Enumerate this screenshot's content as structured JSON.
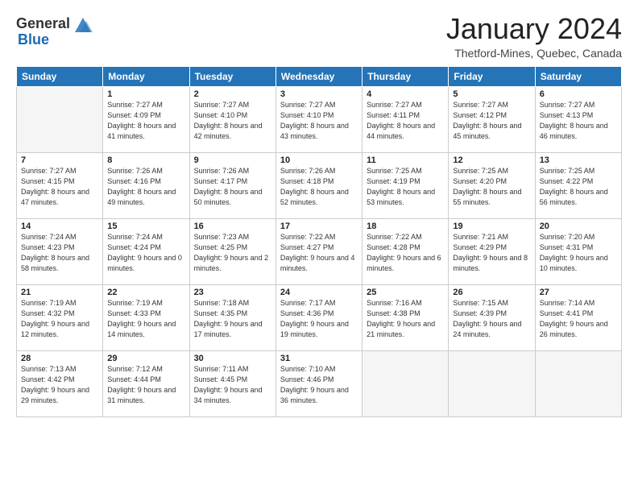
{
  "header": {
    "logo_general": "General",
    "logo_blue": "Blue",
    "month_title": "January 2024",
    "subtitle": "Thetford-Mines, Quebec, Canada"
  },
  "days_of_week": [
    "Sunday",
    "Monday",
    "Tuesday",
    "Wednesday",
    "Thursday",
    "Friday",
    "Saturday"
  ],
  "weeks": [
    [
      {
        "num": "",
        "empty": true,
        "sunrise": "",
        "sunset": "",
        "daylight": ""
      },
      {
        "num": "1",
        "empty": false,
        "sunrise": "7:27 AM",
        "sunset": "4:09 PM",
        "daylight": "8 hours and 41 minutes."
      },
      {
        "num": "2",
        "empty": false,
        "sunrise": "7:27 AM",
        "sunset": "4:10 PM",
        "daylight": "8 hours and 42 minutes."
      },
      {
        "num": "3",
        "empty": false,
        "sunrise": "7:27 AM",
        "sunset": "4:10 PM",
        "daylight": "8 hours and 43 minutes."
      },
      {
        "num": "4",
        "empty": false,
        "sunrise": "7:27 AM",
        "sunset": "4:11 PM",
        "daylight": "8 hours and 44 minutes."
      },
      {
        "num": "5",
        "empty": false,
        "sunrise": "7:27 AM",
        "sunset": "4:12 PM",
        "daylight": "8 hours and 45 minutes."
      },
      {
        "num": "6",
        "empty": false,
        "sunrise": "7:27 AM",
        "sunset": "4:13 PM",
        "daylight": "8 hours and 46 minutes."
      }
    ],
    [
      {
        "num": "7",
        "empty": false,
        "sunrise": "7:27 AM",
        "sunset": "4:15 PM",
        "daylight": "8 hours and 47 minutes."
      },
      {
        "num": "8",
        "empty": false,
        "sunrise": "7:26 AM",
        "sunset": "4:16 PM",
        "daylight": "8 hours and 49 minutes."
      },
      {
        "num": "9",
        "empty": false,
        "sunrise": "7:26 AM",
        "sunset": "4:17 PM",
        "daylight": "8 hours and 50 minutes."
      },
      {
        "num": "10",
        "empty": false,
        "sunrise": "7:26 AM",
        "sunset": "4:18 PM",
        "daylight": "8 hours and 52 minutes."
      },
      {
        "num": "11",
        "empty": false,
        "sunrise": "7:25 AM",
        "sunset": "4:19 PM",
        "daylight": "8 hours and 53 minutes."
      },
      {
        "num": "12",
        "empty": false,
        "sunrise": "7:25 AM",
        "sunset": "4:20 PM",
        "daylight": "8 hours and 55 minutes."
      },
      {
        "num": "13",
        "empty": false,
        "sunrise": "7:25 AM",
        "sunset": "4:22 PM",
        "daylight": "8 hours and 56 minutes."
      }
    ],
    [
      {
        "num": "14",
        "empty": false,
        "sunrise": "7:24 AM",
        "sunset": "4:23 PM",
        "daylight": "8 hours and 58 minutes."
      },
      {
        "num": "15",
        "empty": false,
        "sunrise": "7:24 AM",
        "sunset": "4:24 PM",
        "daylight": "9 hours and 0 minutes."
      },
      {
        "num": "16",
        "empty": false,
        "sunrise": "7:23 AM",
        "sunset": "4:25 PM",
        "daylight": "9 hours and 2 minutes."
      },
      {
        "num": "17",
        "empty": false,
        "sunrise": "7:22 AM",
        "sunset": "4:27 PM",
        "daylight": "9 hours and 4 minutes."
      },
      {
        "num": "18",
        "empty": false,
        "sunrise": "7:22 AM",
        "sunset": "4:28 PM",
        "daylight": "9 hours and 6 minutes."
      },
      {
        "num": "19",
        "empty": false,
        "sunrise": "7:21 AM",
        "sunset": "4:29 PM",
        "daylight": "9 hours and 8 minutes."
      },
      {
        "num": "20",
        "empty": false,
        "sunrise": "7:20 AM",
        "sunset": "4:31 PM",
        "daylight": "9 hours and 10 minutes."
      }
    ],
    [
      {
        "num": "21",
        "empty": false,
        "sunrise": "7:19 AM",
        "sunset": "4:32 PM",
        "daylight": "9 hours and 12 minutes."
      },
      {
        "num": "22",
        "empty": false,
        "sunrise": "7:19 AM",
        "sunset": "4:33 PM",
        "daylight": "9 hours and 14 minutes."
      },
      {
        "num": "23",
        "empty": false,
        "sunrise": "7:18 AM",
        "sunset": "4:35 PM",
        "daylight": "9 hours and 17 minutes."
      },
      {
        "num": "24",
        "empty": false,
        "sunrise": "7:17 AM",
        "sunset": "4:36 PM",
        "daylight": "9 hours and 19 minutes."
      },
      {
        "num": "25",
        "empty": false,
        "sunrise": "7:16 AM",
        "sunset": "4:38 PM",
        "daylight": "9 hours and 21 minutes."
      },
      {
        "num": "26",
        "empty": false,
        "sunrise": "7:15 AM",
        "sunset": "4:39 PM",
        "daylight": "9 hours and 24 minutes."
      },
      {
        "num": "27",
        "empty": false,
        "sunrise": "7:14 AM",
        "sunset": "4:41 PM",
        "daylight": "9 hours and 26 minutes."
      }
    ],
    [
      {
        "num": "28",
        "empty": false,
        "sunrise": "7:13 AM",
        "sunset": "4:42 PM",
        "daylight": "9 hours and 29 minutes."
      },
      {
        "num": "29",
        "empty": false,
        "sunrise": "7:12 AM",
        "sunset": "4:44 PM",
        "daylight": "9 hours and 31 minutes."
      },
      {
        "num": "30",
        "empty": false,
        "sunrise": "7:11 AM",
        "sunset": "4:45 PM",
        "daylight": "9 hours and 34 minutes."
      },
      {
        "num": "31",
        "empty": false,
        "sunrise": "7:10 AM",
        "sunset": "4:46 PM",
        "daylight": "9 hours and 36 minutes."
      },
      {
        "num": "",
        "empty": true,
        "sunrise": "",
        "sunset": "",
        "daylight": ""
      },
      {
        "num": "",
        "empty": true,
        "sunrise": "",
        "sunset": "",
        "daylight": ""
      },
      {
        "num": "",
        "empty": true,
        "sunrise": "",
        "sunset": "",
        "daylight": ""
      }
    ]
  ]
}
